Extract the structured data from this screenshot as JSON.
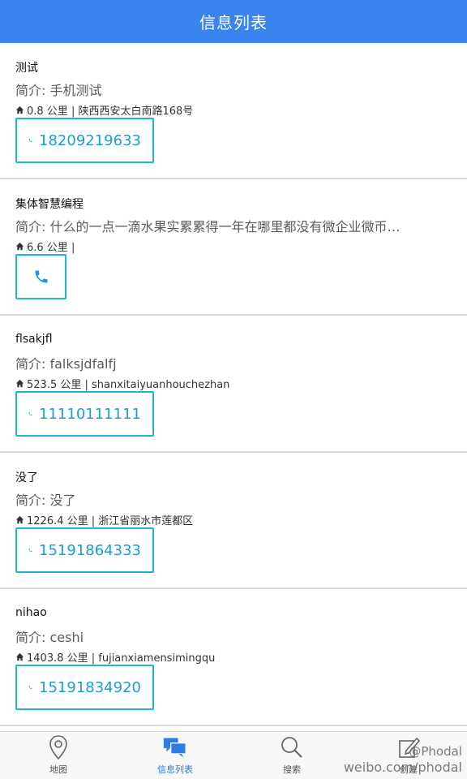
{
  "header": {
    "title": "信息列表"
  },
  "items": [
    {
      "title": "测试",
      "desc": "简介: 手机测试",
      "distance": "0.8 公里 | 陕西西安太白南路168号",
      "phone": "18209219633"
    },
    {
      "title": "集体智慧编程",
      "desc": "简介: 什么的一点一滴水果实累累得一年在哪里都没有微企业微币…",
      "distance": "6.6 公里 |",
      "phone": ""
    },
    {
      "title": "flsakjfl",
      "desc": "简介: falksjdfalfj",
      "distance": "523.5 公里 | shanxitaiyuanhouchezhan",
      "phone": "11110111111"
    },
    {
      "title": "没了",
      "desc": "简介: 没了",
      "distance": "1226.4 公里 | 浙江省丽水市莲都区",
      "phone": "15191864333"
    },
    {
      "title": "nihao",
      "desc": "简介: ceshi",
      "distance": "1403.8 公里 | fujianxiamensimingqu",
      "phone": "15191834920"
    }
  ],
  "tabs": [
    {
      "label": "地图",
      "icon": "map-pin-icon"
    },
    {
      "label": "信息列表",
      "icon": "chat-list-icon"
    },
    {
      "label": "搜索",
      "icon": "search-icon"
    },
    {
      "label": "创建",
      "icon": "edit-icon"
    }
  ],
  "watermark": {
    "line1": "@Phodal",
    "line2": "weibo.com/phodal"
  },
  "colors": {
    "header": "#3b84f0",
    "accent": "#1fb5d8",
    "active_tab": "#2e7be6"
  }
}
